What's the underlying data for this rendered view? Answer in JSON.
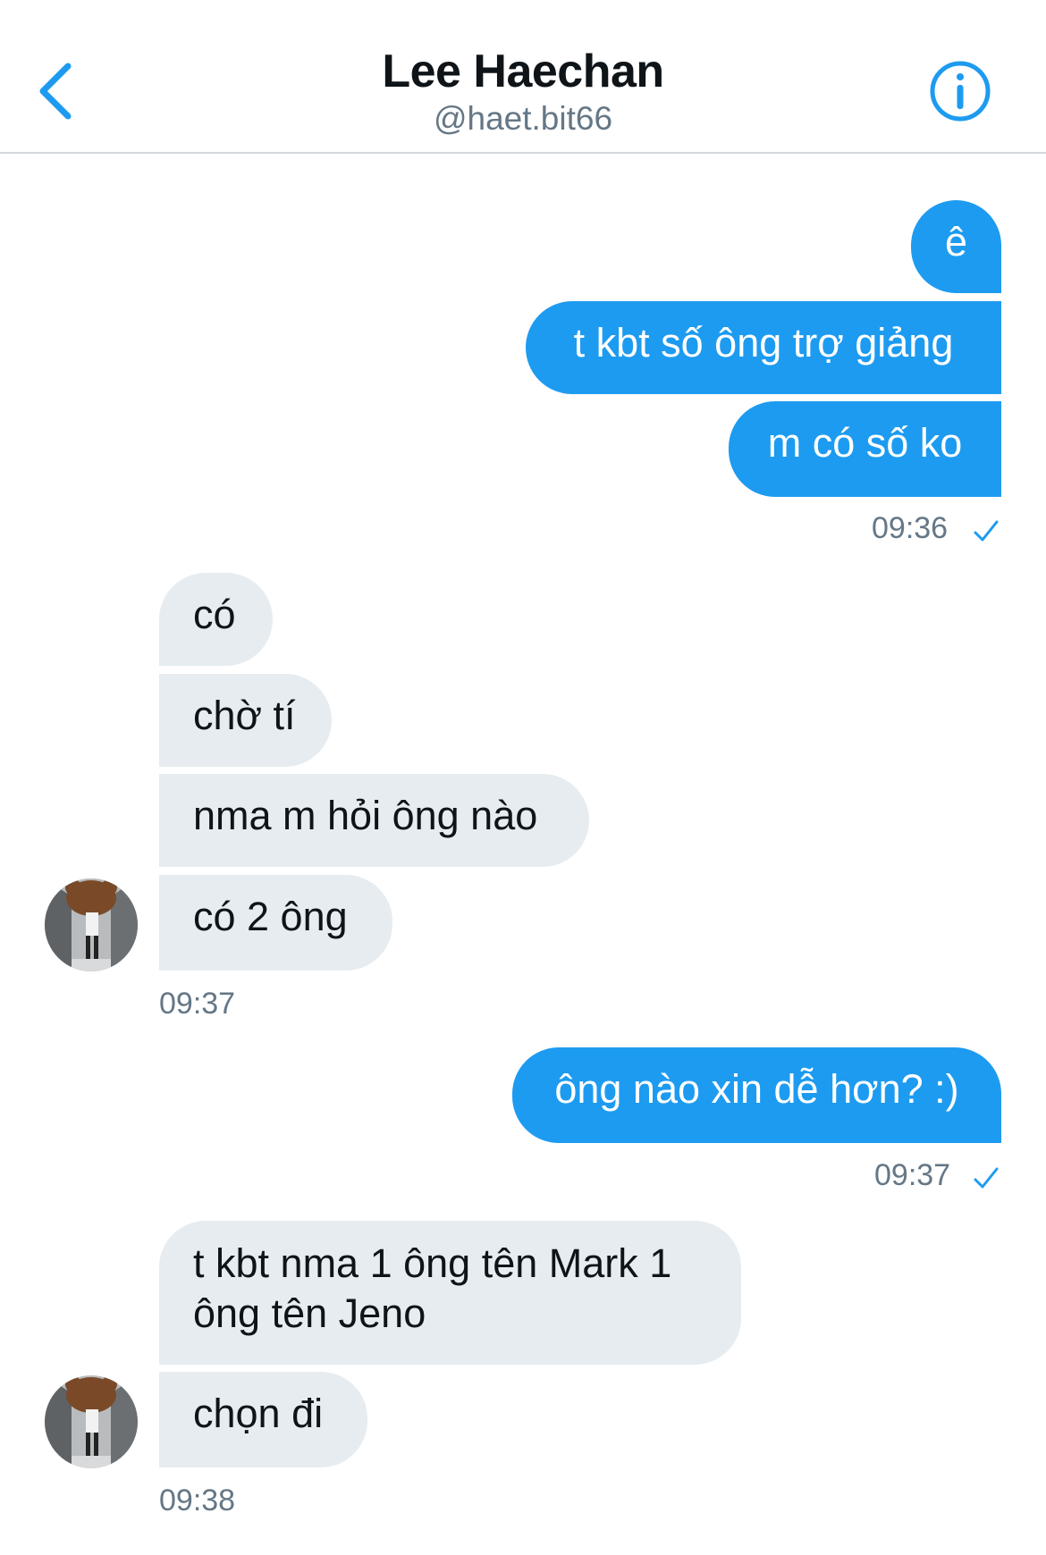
{
  "header": {
    "title": "Lee Haechan",
    "handle": "@haet.bit66",
    "back_icon": "chevron-left-icon",
    "info_icon": "info-icon",
    "accent_color": "#1d9bf0"
  },
  "messages": [
    {
      "direction": "outgoing",
      "text": "ê"
    },
    {
      "direction": "outgoing",
      "text": "t kbt số ông trợ giảng"
    },
    {
      "direction": "outgoing",
      "text": "m có số ko"
    },
    {
      "direction": "outgoing_timestamp",
      "text": "09:36"
    },
    {
      "direction": "incoming",
      "text": "có"
    },
    {
      "direction": "incoming",
      "text": "chờ tí"
    },
    {
      "direction": "incoming",
      "text": "nma m hỏi ông nào"
    },
    {
      "direction": "incoming",
      "text": "có 2 ông"
    },
    {
      "direction": "incoming_timestamp",
      "text": "09:37"
    },
    {
      "direction": "outgoing",
      "text": "ông nào xin dễ hơn? :)"
    },
    {
      "direction": "outgoing_timestamp",
      "text": "09:37"
    },
    {
      "direction": "incoming",
      "text": "t kbt nma 1 ông tên Mark 1",
      "text_line2": "ông tên Jeno"
    },
    {
      "direction": "incoming",
      "text": "chọn đi"
    },
    {
      "direction": "incoming_timestamp",
      "text": "09:38"
    }
  ],
  "colors": {
    "outgoing_bubble": "#1d9bf0",
    "incoming_bubble": "#e6ecf0",
    "timestamp": "#657786"
  }
}
